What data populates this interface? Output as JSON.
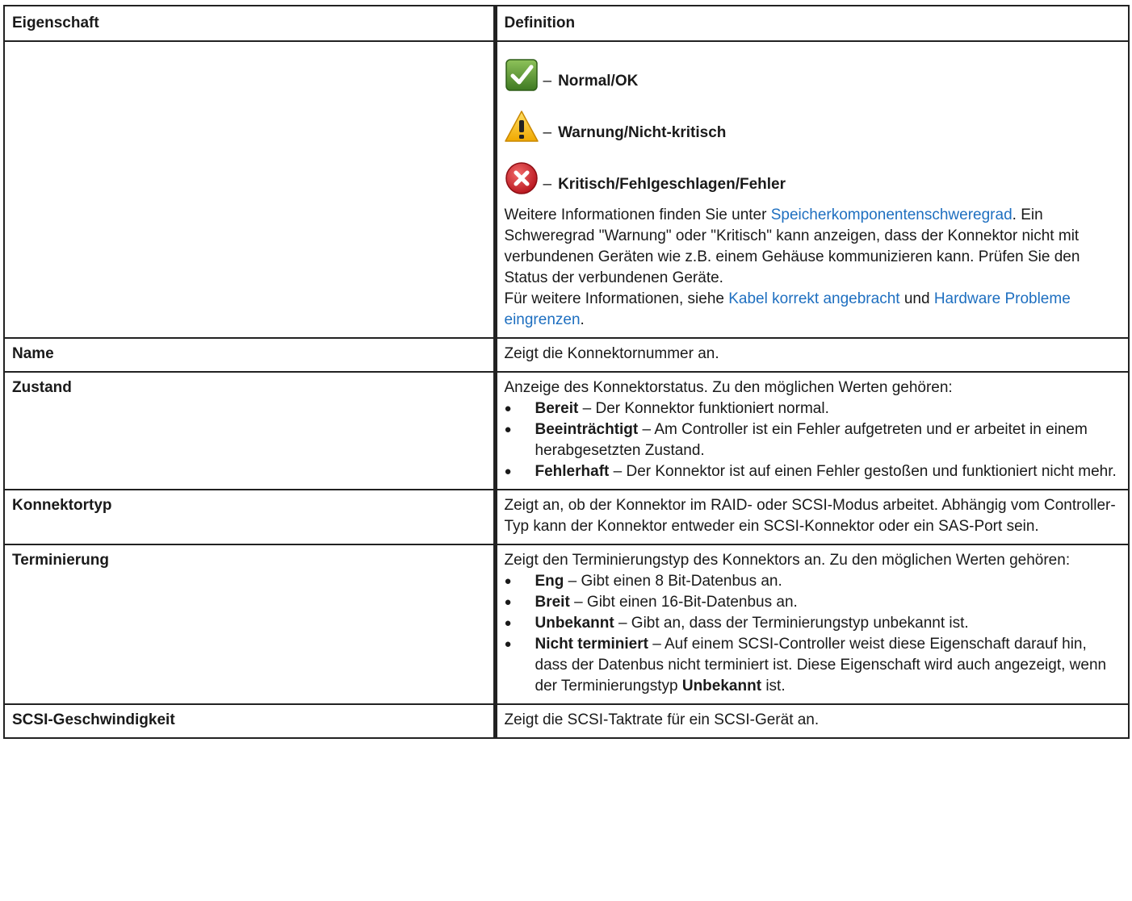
{
  "header": {
    "col1": "Eigenschaft",
    "col2": "Definition"
  },
  "severity": {
    "dash": "–",
    "ok": "Normal/OK",
    "warn": "Warnung/Nicht-kritisch",
    "crit": "Kritisch/Fehlgeschlagen/Fehler",
    "colors": {
      "ok": "#4e8a2a",
      "warn": "#f2b600",
      "crit": "#d8232a"
    },
    "icons": [
      "check-icon",
      "warning-icon",
      "error-icon"
    ],
    "p1_pre": "Weitere Informationen finden Sie unter ",
    "p1_link": "Speicherkomponentenschweregrad",
    "p1_post": ".",
    "p2": " Ein Schweregrad \"Warnung\" oder \"Kritisch\" kann anzeigen, dass der Konnektor nicht mit verbundenen Geräten wie z.B. einem Gehäuse kommunizieren kann. Prüfen Sie den Status der verbundenen Geräte.",
    "p3_pre": "Für weitere Informationen, siehe ",
    "p3_link1": "Kabel korrekt angebracht",
    "p3_mid": " und ",
    "p3_link2": "Hardware Probleme eingrenzen",
    "p3_post": "."
  },
  "rows": {
    "name": {
      "prop": "Name",
      "def": "Zeigt die Konnektornummer an."
    },
    "zustand": {
      "prop": "Zustand",
      "intro": "Anzeige des Konnektorstatus. Zu den möglichen Werten gehören:",
      "items": [
        {
          "term": "Bereit",
          "text": " – Der Konnektor funktioniert normal."
        },
        {
          "term": "Beeinträchtigt",
          "text": " – Am Controller ist ein Fehler aufgetreten und er arbeitet in einem herabgesetzten Zustand."
        },
        {
          "term": "Fehlerhaft",
          "text": " – Der Konnektor ist auf einen Fehler gestoßen und funktioniert nicht mehr."
        }
      ]
    },
    "konnektortyp": {
      "prop": "Konnektortyp",
      "def": "Zeigt an, ob der Konnektor im RAID- oder SCSI-Modus arbeitet. Abhängig vom Controller-Typ kann der Konnektor entweder ein SCSI-Konnektor oder ein SAS-Port sein."
    },
    "terminierung": {
      "prop": "Terminierung",
      "intro": "Zeigt den Terminierungstyp des Konnektors an. Zu den möglichen Werten gehören:",
      "items": [
        {
          "term": "Eng",
          "text": " – Gibt einen 8 Bit-Datenbus an."
        },
        {
          "term": "Breit",
          "text": " – Gibt einen 16-Bit-Datenbus an."
        },
        {
          "term": "Unbekannt",
          "text": " – Gibt an, dass der Terminierungstyp unbekannt ist."
        }
      ],
      "last_term": "Nicht terminiert",
      "last_text": " – Auf einem SCSI-Controller weist diese Eigenschaft darauf hin, dass der Datenbus nicht terminiert ist. Diese Eigenschaft wird auch angezeigt, wenn der Terminierungstyp ",
      "last_bold": "Unbekannt",
      "last_end": " ist."
    },
    "scsi": {
      "prop": "SCSI-Geschwindigkeit",
      "def": "Zeigt die SCSI-Taktrate für ein SCSI-Gerät an."
    }
  }
}
